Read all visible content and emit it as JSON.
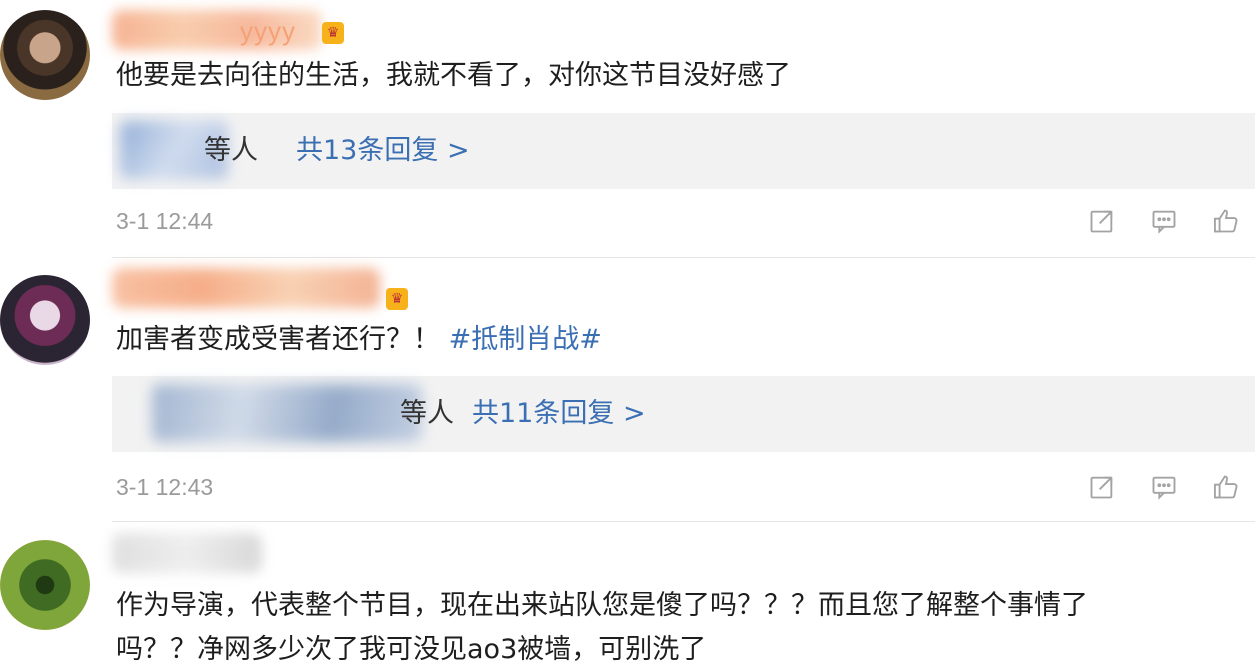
{
  "comments": [
    {
      "handle_suffix": "yyyy",
      "text": "他要是去向往的生活，我就不看了，对你这节目没好感了",
      "reply_prefix": "等人",
      "reply_link": "共13条回复 >",
      "time": "3-1 12:44"
    },
    {
      "handle_suffix": "",
      "text_plain": "加害者变成受害者还行？！",
      "hashtag": "#抵制肖战#",
      "reply_prefix": "等人",
      "reply_link": "共11条回复 >",
      "time": "3-1 12:43"
    },
    {
      "handle_suffix": "",
      "text_line1": "作为导演，代表整个节目，现在出来站队您是傻了吗？？？而且您了解整个事情了",
      "text_line2": "吗？？净网多少次了我可没见ao3被墙，可别洗了"
    }
  ],
  "icons": {
    "share": "share-icon",
    "comment": "comment-icon",
    "like": "thumbs-up-icon",
    "badge": "crown-badge-icon"
  },
  "colors": {
    "link": "#3b6fb3",
    "time": "#9a9a9a",
    "reply_bg": "#f2f2f2"
  }
}
